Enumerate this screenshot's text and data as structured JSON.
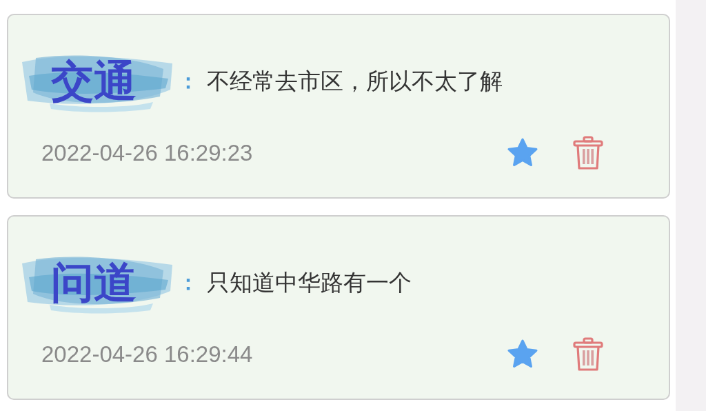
{
  "comments": [
    {
      "title": "交通",
      "separator": "：",
      "content": "不经常去市区，所以不太了解",
      "time": "2022-04-26 16:29:23",
      "starred": true
    },
    {
      "title": "问道",
      "separator": "：",
      "content": "只知道中华路有一个",
      "time": "2022-04-26 16:29:44",
      "starred": true
    }
  ]
}
